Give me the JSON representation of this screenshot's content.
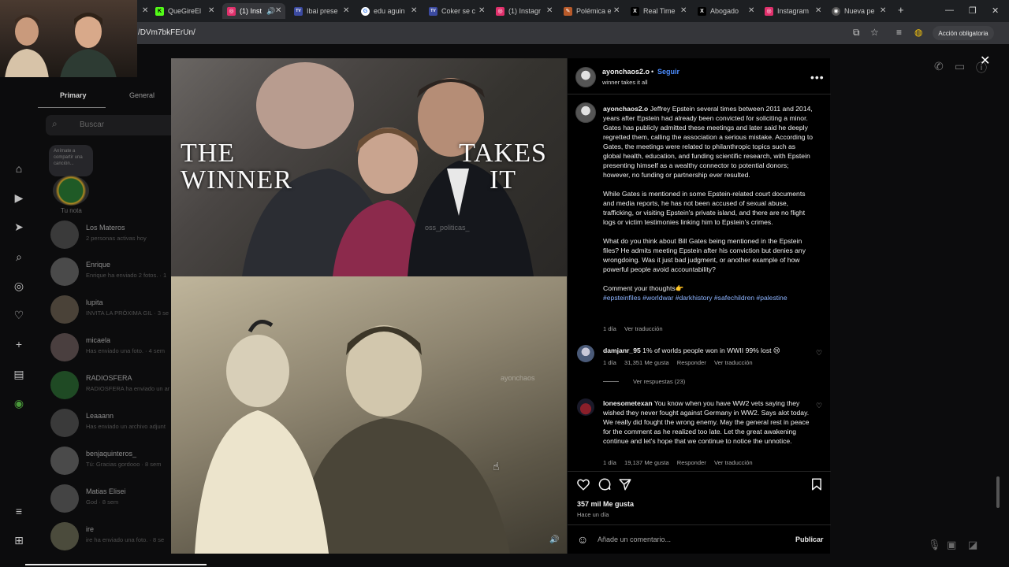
{
  "browser": {
    "tabs": [
      {
        "label": "QueGireEl",
        "icon_color": "#53fc18",
        "icon_text": "K"
      },
      {
        "label": "(1) Inst",
        "icon_color": "#e1306c",
        "icon_text": "◎",
        "active": true
      },
      {
        "label": "Ibai prese",
        "icon_color": "#3b4aa0",
        "icon_text": "TV"
      },
      {
        "label": "edu aguin",
        "icon_color": "#4285f4",
        "icon_text": "G"
      },
      {
        "label": "Coker se c",
        "icon_color": "#3b4aa0",
        "icon_text": "TV"
      },
      {
        "label": "(1) Instagr",
        "icon_color": "#e1306c",
        "icon_text": "◎"
      },
      {
        "label": "Polémica e",
        "icon_color": "#b85a2a",
        "icon_text": "✎"
      },
      {
        "label": "Real Time",
        "icon_color": "#222222",
        "icon_text": "X"
      },
      {
        "label": "Abogado",
        "icon_color": "#222222",
        "icon_text": "X"
      },
      {
        "label": "Instagram",
        "icon_color": "#e1306c",
        "icon_text": "◎"
      },
      {
        "label": "Nueva pe",
        "icon_color": "#555555",
        "icon_text": "◉"
      }
    ],
    "new_tab": "+",
    "url": "/DVm7bkFErUn/",
    "action_button": "Acción obligatoria"
  },
  "inbox": {
    "tab_primary": "Primary",
    "tab_general": "General",
    "search_placeholder": "Buscar",
    "note_bubble": "Anímate a compartir una canción...",
    "note_label": "Tu nota",
    "chats": [
      {
        "name": "Los Materos",
        "sub": "2 personas activas hoy",
        "color": "#3a3a3a"
      },
      {
        "name": "Enrique",
        "sub": "Enrique ha enviado 2 fotos. · 1",
        "color": "#4a4a4a"
      },
      {
        "name": "lupita",
        "sub": "INVITA LA PRÓXIMA GIL · 3 se",
        "color": "#4a4238"
      },
      {
        "name": "micaela",
        "sub": "Has enviado una foto. · 4 sem",
        "color": "#4a3f3f"
      },
      {
        "name": "RADIOSFERA",
        "sub": "RADIOSFERA ha enviado un ar",
        "color": "#1f4a24"
      },
      {
        "name": "Leaaann",
        "sub": "Has enviado un archivo adjunt",
        "color": "#3a3a3a"
      },
      {
        "name": "benjaquinteros_",
        "sub": "Tú: Gracias gordooo · 8 sem",
        "color": "#4a4a4a"
      },
      {
        "name": "Matias Elisei",
        "sub": "God · 8 sem",
        "color": "#444444"
      },
      {
        "name": "ire",
        "sub": "ire ha enviado una foto. · 8 se",
        "color": "#4b4b3c"
      }
    ]
  },
  "media": {
    "overlay_left": "THE WINNER",
    "overlay_right": "TAKES IT",
    "watermark_top": "oss_politicas_",
    "watermark_bottom": "ayonchaos"
  },
  "post": {
    "username": "ayonchaos2.o",
    "follow": "Seguir",
    "audio": "winner takes it all",
    "caption_user": "ayonchaos2.o",
    "caption_p1": "Jeffrey Epstein several times between 2011 and 2014, years after Epstein had already been convicted for soliciting a minor. Gates has publicly admitted these meetings and later said he deeply regretted them, calling the association a serious mistake. According to Gates, the meetings were related to philanthropic topics such as global health, education, and funding scientific research, with Epstein presenting himself as a wealthy connector to potential donors; however, no funding or partnership ever resulted.",
    "caption_p2": "While Gates is mentioned in some Epstein-related court documents and media reports, he has not been accused of sexual abuse, trafficking, or visiting Epstein's private island, and there are no flight logs or victim testimonies linking him to Epstein's crimes.",
    "caption_p3": "What do you think about Bill Gates being mentioned in the Epstein files? He admits meeting Epstein after his conviction but denies any wrongdoing. Was it just bad judgment, or another example of how powerful people avoid accountability?",
    "caption_p4": "Comment your thoughts👉",
    "hashtags": "#epsteinfiles #worldwar #darkhistory #safechildren #palestine",
    "caption_time": "1 día",
    "caption_translate": "Ver traducción",
    "comments": [
      {
        "user": "damjanr_95",
        "text": "1% of worlds people won in WWII 99% lost 😢",
        "time": "1 día",
        "likes": "31,351 Me gusta",
        "reply": "Responder",
        "translate": "Ver traducción"
      },
      {
        "user": "lonesometexan",
        "text": "You know when you have WW2 vets saying they wished they never fought against Germany in WW2. Says alot today. We really did fought the wrong enemy. May the general rest in peace for the comment as he realized too late. Let the great awakening continue and let's hope that we continue to notice the unnotice.",
        "time": "1 día",
        "likes": "19,137 Me gusta",
        "reply": "Responder",
        "translate": "Ver traducción"
      }
    ],
    "view_replies": "Ver respuestas (23)",
    "like_count": "357 mil Me gusta",
    "posted": "Hace un día",
    "add_comment_placeholder": "Añade un comentario...",
    "publish": "Publicar"
  },
  "colors": {
    "accent": "#4c8dff",
    "hashtag": "#8db4ff",
    "modal_bg": "#000000"
  }
}
